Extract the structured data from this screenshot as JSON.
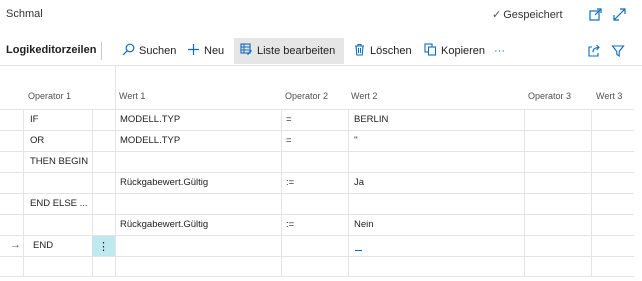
{
  "header": {
    "title": "Schmal",
    "saved_status": "Gespeichert"
  },
  "toolbar": {
    "title": "Logikeditorzeilen",
    "search": "Suchen",
    "new": "Neu",
    "edit_list": "Liste bearbeiten",
    "delete": "Löschen",
    "copy": "Kopieren",
    "more": "···"
  },
  "columns": [
    "Operator 1",
    "Wert 1",
    "Operator 2",
    "Wert 2",
    "Operator 3",
    "Wert 3"
  ],
  "rows": [
    {
      "op1": "IF",
      "wert1": "MODELL.TYP",
      "op2": "=",
      "wert2": "BERLIN"
    },
    {
      "op1": "OR",
      "wert1": "MODELL.TYP",
      "op2": "=",
      "wert2": "''"
    },
    {
      "op1": "THEN BEGIN",
      "wert1": "",
      "op2": "",
      "wert2": ""
    },
    {
      "op1": "",
      "wert1": "Rückgabewert.Gültig",
      "op2": ":=",
      "wert2": "Ja"
    },
    {
      "op1": "END ELSE ...",
      "wert1": "",
      "op2": "",
      "wert2": ""
    },
    {
      "op1": "",
      "wert1": "Rückgabewert.Gültig",
      "op2": ":=",
      "wert2": "Nein"
    },
    {
      "op1": "END",
      "wert1": "",
      "op2": "",
      "wert2": ""
    },
    {
      "op1": "",
      "wert1": "",
      "op2": "",
      "wert2": ""
    }
  ],
  "icons": {
    "saved": "check-icon",
    "open_new_window": "open-in-new-window-icon",
    "collapse": "collapse-icon",
    "search": "search-icon",
    "new": "plus-icon",
    "edit_list": "edit-list-icon",
    "delete": "trash-icon",
    "copy": "copy-icon",
    "share": "share-icon",
    "filter": "filter-icon",
    "current_row": "arrow-right-icon",
    "row_actions": "vertical-dots-icon"
  },
  "colors": {
    "accent": "#0f6cbd",
    "selected_cell": "#bfe9ee",
    "active_button_bg": "#e6e6e6"
  }
}
